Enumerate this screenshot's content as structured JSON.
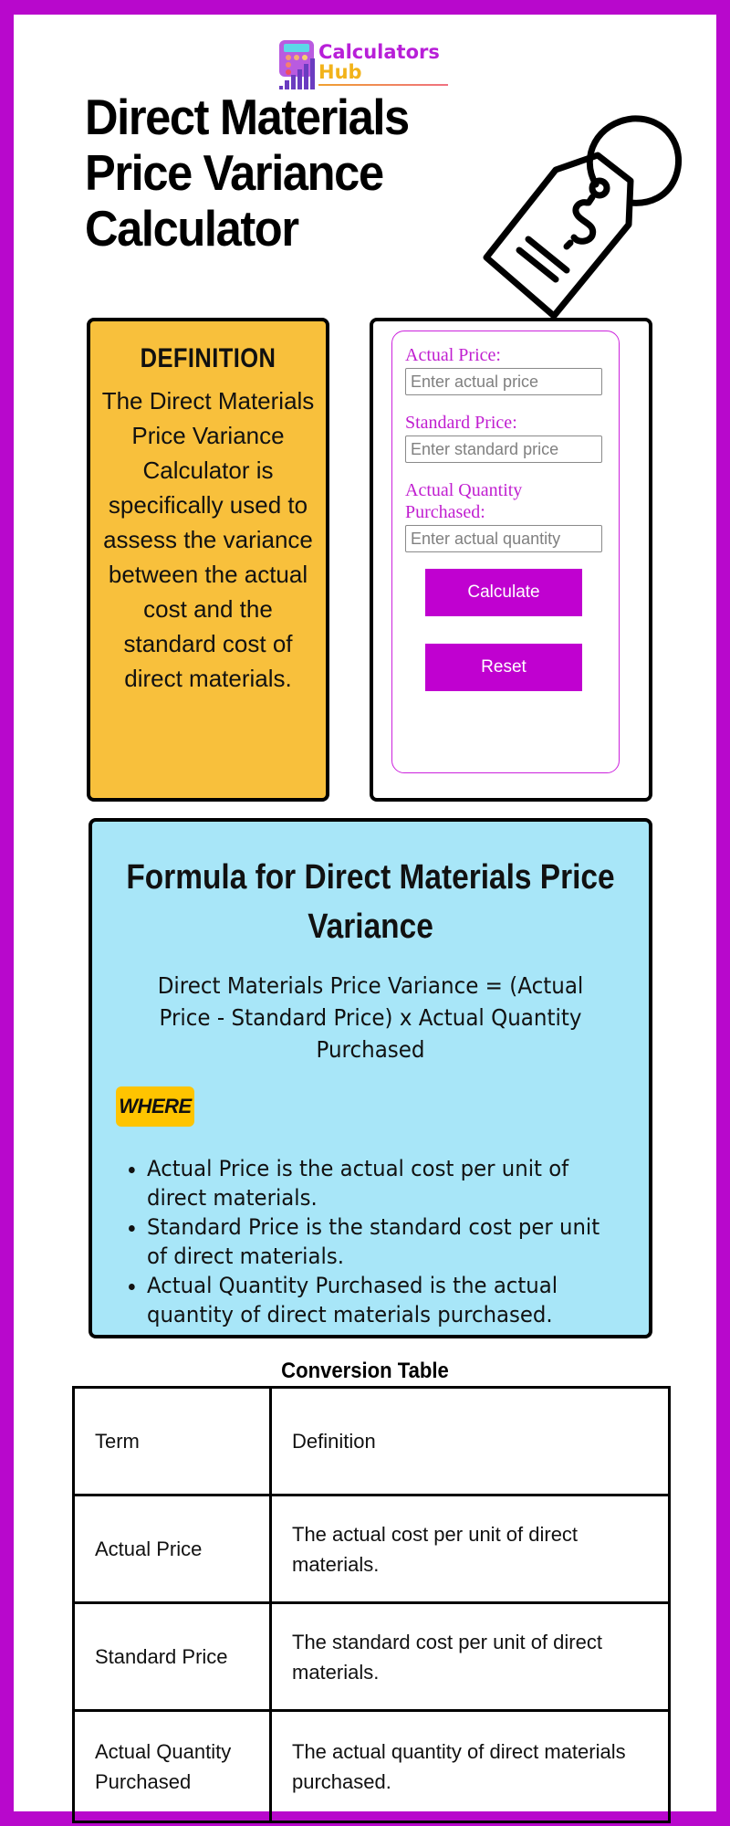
{
  "brand": {
    "name_line1": "Calculators",
    "name_line2": "Hub",
    "logo_icon": "calculator-chart-icon",
    "colors": {
      "frame": "#b808cc",
      "primary": "#c001d0",
      "definition_bg": "#f8c03c",
      "formula_bg": "#a8e6f8",
      "badge": "#ffc400"
    }
  },
  "header": {
    "title": "Direct Materials Price Variance Calculator",
    "icon": "price-tag-icon"
  },
  "definition": {
    "heading": "DEFINITION",
    "text": "The Direct Materials Price Variance Calculator is specifically used to assess the variance between the actual cost and the standard cost of direct materials."
  },
  "calculator": {
    "fields": [
      {
        "label": "Actual Price:",
        "placeholder": "Enter actual price",
        "value": ""
      },
      {
        "label": "Standard Price:",
        "placeholder": "Enter standard price",
        "value": ""
      },
      {
        "label": "Actual Quantity Purchased:",
        "placeholder": "Enter actual quantity",
        "value": ""
      }
    ],
    "calculate_label": "Calculate",
    "reset_label": "Reset"
  },
  "formula": {
    "title": "Formula for Direct Materials Price Variance",
    "equation": "Direct Materials Price Variance = (Actual Price - Standard Price) x Actual Quantity Purchased",
    "where_label": "WHERE",
    "items": [
      "Actual Price is the actual cost per unit of direct materials.",
      "Standard Price is the standard cost per unit of direct materials.",
      "Actual Quantity Purchased is the actual quantity of direct materials purchased."
    ]
  },
  "table": {
    "title": "Conversion Table",
    "headers": [
      "Term",
      "Definition"
    ],
    "rows": [
      [
        "Actual Price",
        "The actual cost per unit of direct materials."
      ],
      [
        "Standard Price",
        "The standard cost per unit of direct materials."
      ],
      [
        "Actual Quantity Purchased",
        "The actual quantity of direct materials purchased."
      ]
    ]
  }
}
